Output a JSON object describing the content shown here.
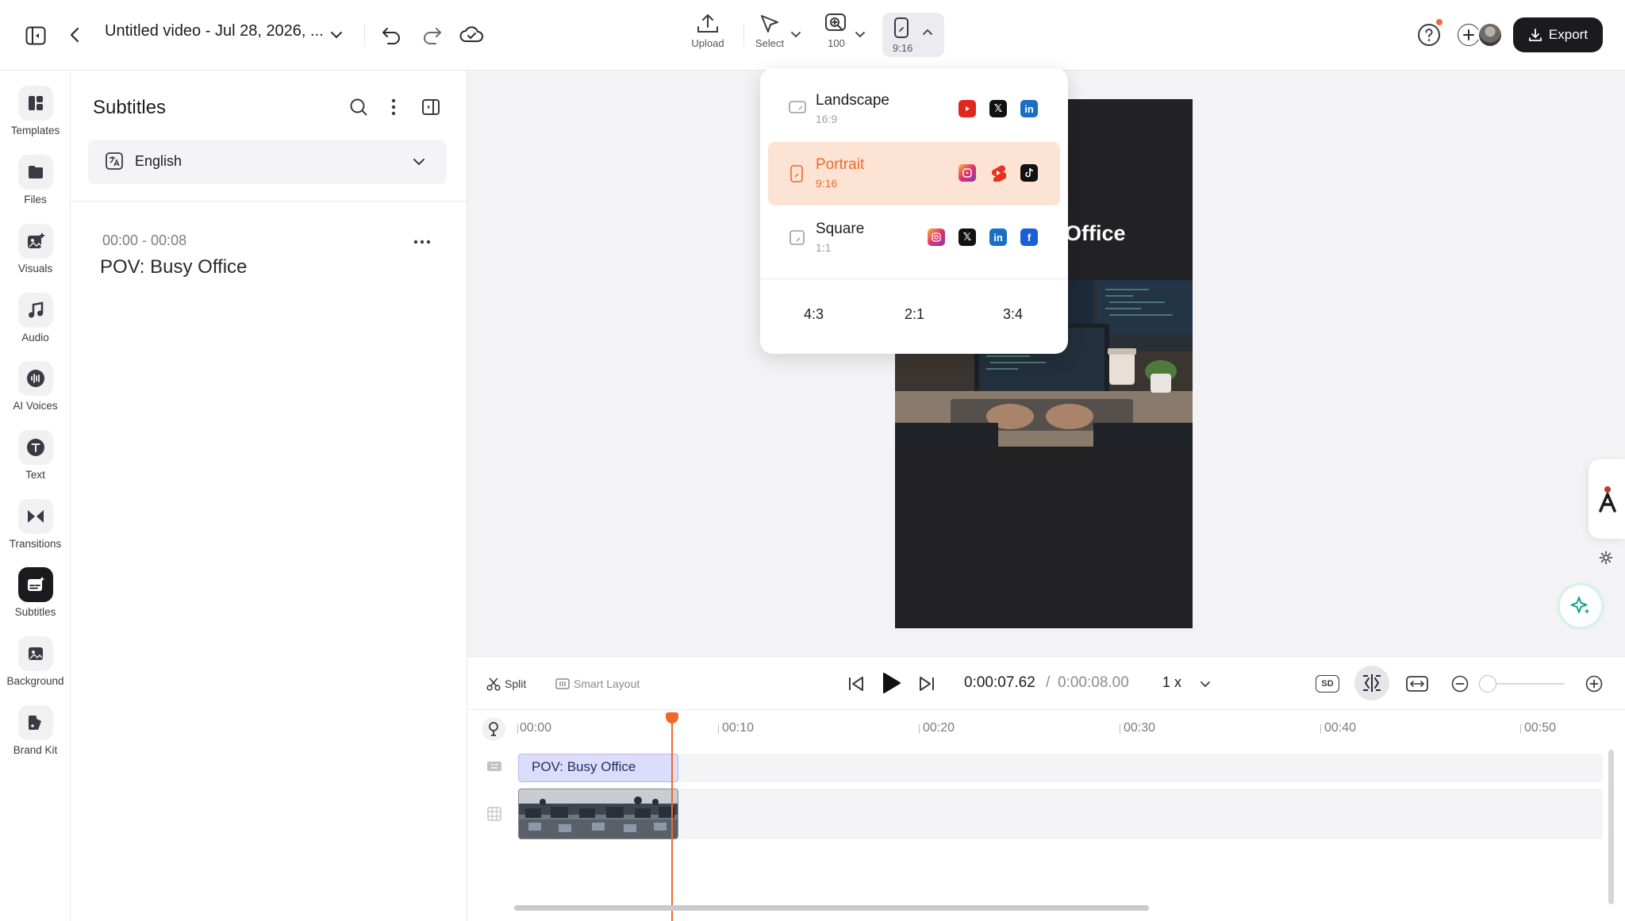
{
  "header": {
    "title": "Untitled video - Jul 28, 2026, ...",
    "tools": {
      "upload": "Upload",
      "select": "Select",
      "zoom": "100",
      "ratio": "9:16"
    },
    "export_label": "Export"
  },
  "leftnav": {
    "items": [
      {
        "label": "Templates",
        "icon": "templates-icon"
      },
      {
        "label": "Files",
        "icon": "folder-icon"
      },
      {
        "label": "Visuals",
        "icon": "image-plus-icon"
      },
      {
        "label": "Audio",
        "icon": "music-note-icon"
      },
      {
        "label": "AI Voices",
        "icon": "voice-wave-icon"
      },
      {
        "label": "Text",
        "icon": "text-t-icon"
      },
      {
        "label": "Transitions",
        "icon": "bowtie-icon"
      },
      {
        "label": "Subtitles",
        "icon": "subtitles-icon",
        "active": true
      },
      {
        "label": "Background",
        "icon": "background-image-icon"
      },
      {
        "label": "Brand Kit",
        "icon": "brand-kit-icon"
      }
    ]
  },
  "panel": {
    "title": "Subtitles",
    "language": "English",
    "subtitle": {
      "time": "00:00 - 00:08",
      "text": "POV: Busy Office"
    }
  },
  "canvas": {
    "overlay_text": "Office"
  },
  "ratio_menu": {
    "options": [
      {
        "name": "Landscape",
        "ratio": "16:9",
        "platforms": [
          "youtube-icon",
          "x-icon",
          "linkedin-icon"
        ]
      },
      {
        "name": "Portrait",
        "ratio": "9:16",
        "platforms": [
          "instagram-reels-icon",
          "youtube-shorts-icon",
          "tiktok-icon"
        ],
        "active": true
      },
      {
        "name": "Square",
        "ratio": "1:1",
        "platforms": [
          "instagram-icon",
          "x-icon",
          "linkedin-icon",
          "facebook-icon"
        ]
      }
    ],
    "extra": [
      "4:3",
      "2:1",
      "3:4"
    ]
  },
  "controls": {
    "split": "Split",
    "smart_layout": "Smart Layout",
    "time_current": "0:00:07.62",
    "time_separator": "/",
    "time_total": "0:00:08.00",
    "speed": "1 x",
    "quality": "SD"
  },
  "timeline": {
    "ticks": [
      "00:00",
      "00:10",
      "00:20",
      "00:30",
      "00:40",
      "00:50"
    ],
    "subtitle_clip": "POV: Busy Office",
    "playhead_seconds": 7.62
  },
  "colors": {
    "accent": "#ef6a2a",
    "dark": "#1b1b1f",
    "selected_row": "#fde3d4",
    "subtitle_clip": "#dcdcfb"
  }
}
